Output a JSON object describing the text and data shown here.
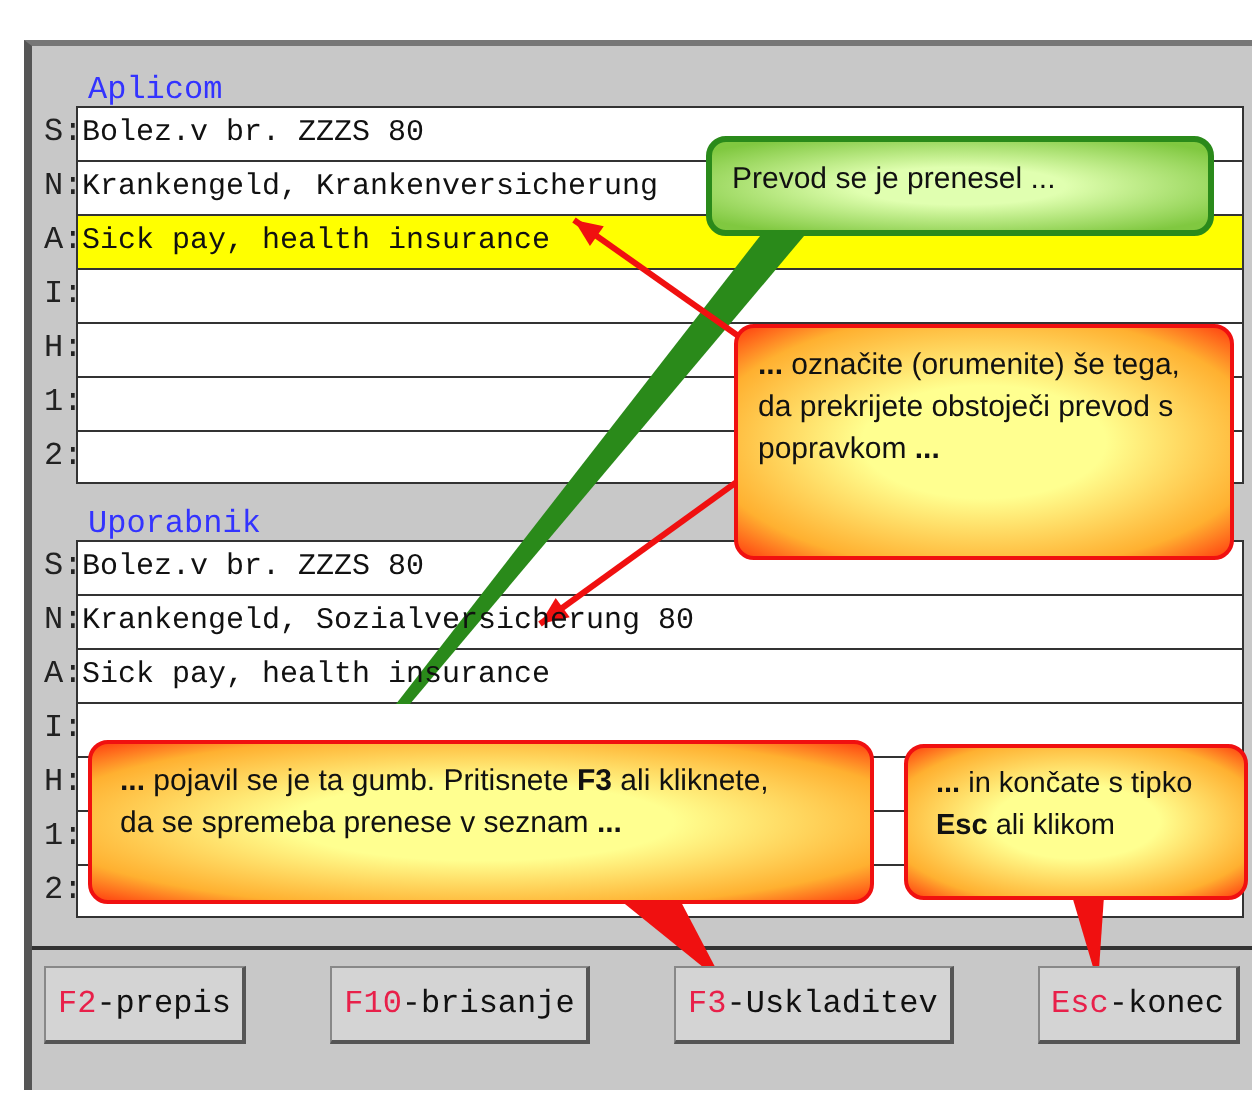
{
  "sections": [
    {
      "title": "Aplicom",
      "rows": [
        {
          "key": "S:",
          "value": "Bolez.v br. ZZZS  80",
          "selected": false
        },
        {
          "key": "N:",
          "value": "Krankengeld, Krankenversicherung",
          "selected": false
        },
        {
          "key": "A:",
          "value": "Sick pay, health insurance",
          "selected": true
        },
        {
          "key": "I:",
          "value": "",
          "selected": false
        },
        {
          "key": "H:",
          "value": "",
          "selected": false
        },
        {
          "key": "1:",
          "value": "",
          "selected": false
        },
        {
          "key": "2:",
          "value": "",
          "selected": false
        }
      ]
    },
    {
      "title": "Uporabnik",
      "rows": [
        {
          "key": "S:",
          "value": "Bolez.v br. ZZZS  80",
          "selected": false
        },
        {
          "key": "N:",
          "value": "Krankengeld, Sozialversicherung  80",
          "selected": false
        },
        {
          "key": "A:",
          "value": "Sick pay, health insurance",
          "selected": false
        },
        {
          "key": "I:",
          "value": "",
          "selected": false
        },
        {
          "key": "H:",
          "value": "",
          "selected": false
        },
        {
          "key": "1:",
          "value": "",
          "selected": false
        },
        {
          "key": "2:",
          "value": "",
          "selected": false
        }
      ]
    }
  ],
  "buttons": [
    {
      "key": "F2",
      "label": "-prepis"
    },
    {
      "key": "F10",
      "label": "-brisanje"
    },
    {
      "key": "F3",
      "label": "-Uskladitev"
    },
    {
      "key": "Esc",
      "label": "-konec"
    }
  ],
  "callouts": [
    {
      "kind": "green",
      "text": "Prevod se je prenesel ..."
    },
    {
      "kind": "red",
      "text": "**...** označite (orumenite) še tega, da prekrijete obstoječi prevod s popravkom **...**"
    },
    {
      "kind": "red",
      "text": "**...** pojavil se je ta gumb. Pritisnete **F3** ali kliknete, da se spremeba prenese v seznam **...**"
    },
    {
      "kind": "red",
      "text": "**...** in končate s tipko **Esc** ali klikom"
    }
  ]
}
